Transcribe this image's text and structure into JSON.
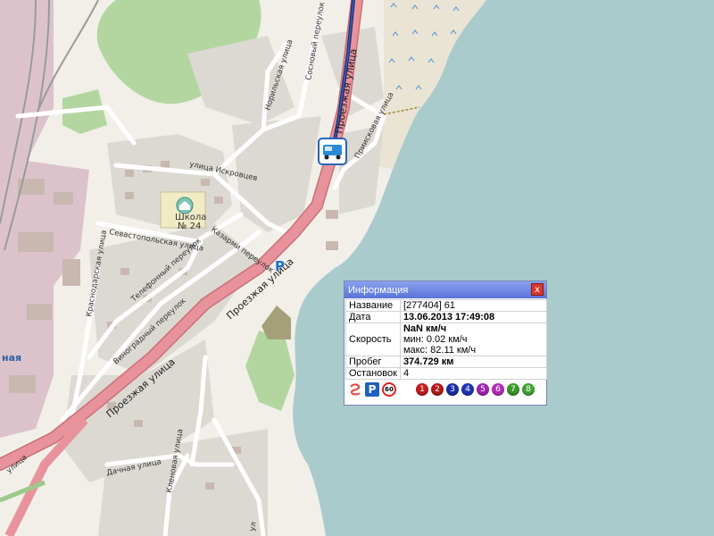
{
  "map": {
    "streets": {
      "main_road_1": "Проезжая улица",
      "main_road_2": "Проезжая улица",
      "main_road_3": "Проезжая улица",
      "north_road": "Проезжая улица",
      "iskrovtsev": "улица Искровцев",
      "sevastopolskaya": "Севастопольская улица",
      "kazarmy": "Казарми переулок",
      "telefonny": "Телефонный переулок",
      "krasnodarskaya": "Краснодарская улица",
      "vinogradny": "Виноградный переулок",
      "norilskaya": "Норильская улица",
      "sosnovy": "Сосновый переулок",
      "priiskovaya": "Приисковая улица",
      "dachnaya": "Дачная улица",
      "klenovaya": "Кленовая улица",
      "partial_left": "ная",
      "partial_bottom_left": "улица",
      "partial_bottom_right": "ул"
    },
    "school": {
      "line1": "Школа",
      "line2": "№ 24"
    },
    "parking_symbol": "P"
  },
  "info_popup": {
    "title": "Информация",
    "close_symbol": "x",
    "rows": {
      "name_label": "Название",
      "name_value": "[277404] 61",
      "date_label": "Дата",
      "date_value": "13.06.2013 17:49:08",
      "speed_label": "Скорость",
      "speed_value": "NaN км/ч",
      "speed_min": "мин: 0.02 км/ч",
      "speed_max": "макс: 82.11 км/ч",
      "mileage_label": "Пробег",
      "mileage_value": "374.729 км",
      "stops_label": "Остановок",
      "stops_value": "4"
    },
    "icons": {
      "parking_symbol": "P",
      "speed_limit": "60",
      "pins": [
        {
          "label": "1",
          "color": "#c21f1f"
        },
        {
          "label": "2",
          "color": "#b81a1a"
        },
        {
          "label": "3",
          "color": "#1a2fa6"
        },
        {
          "label": "4",
          "color": "#2233b8"
        },
        {
          "label": "5",
          "color": "#a326b0"
        },
        {
          "label": "6",
          "color": "#b52fb8"
        },
        {
          "label": "7",
          "color": "#3a9a2b"
        },
        {
          "label": "8",
          "color": "#43a535"
        }
      ]
    }
  },
  "colors": {
    "water": "#aacbcc",
    "land": "#f2efe9",
    "residential": "#dcd9d3",
    "industrial": "#dcc3cb",
    "park": "#b3d6a0",
    "main_road": "#e8939b",
    "route": "#1f2d6b"
  }
}
